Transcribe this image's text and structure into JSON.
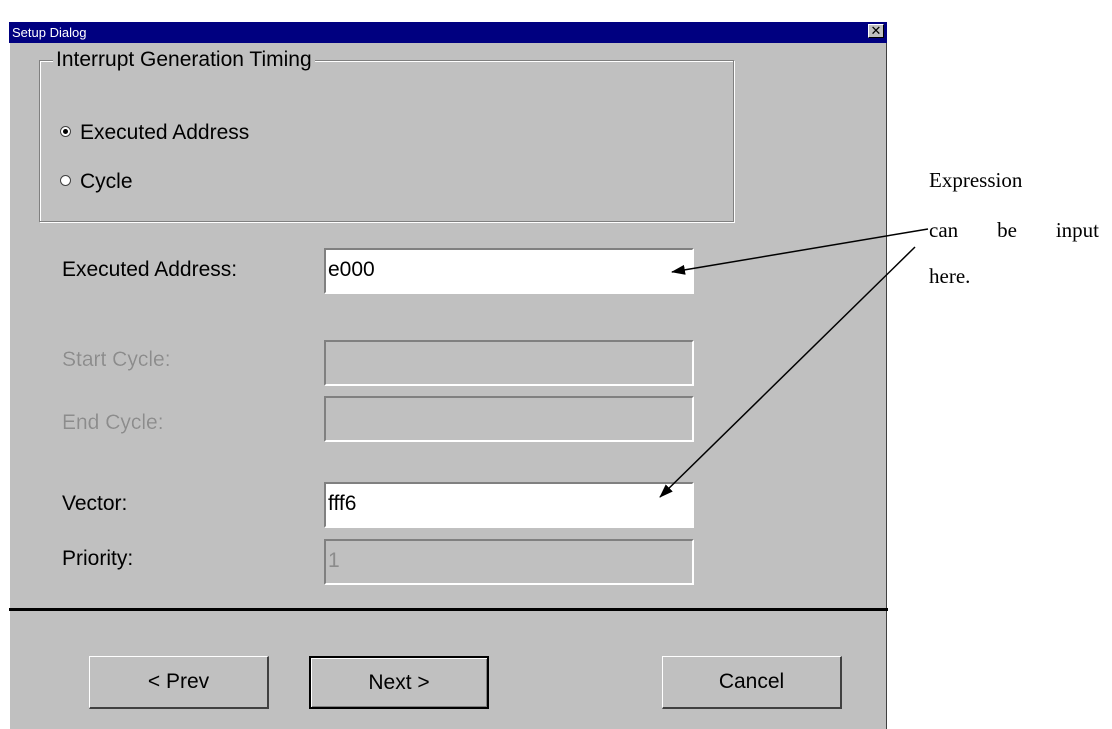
{
  "window": {
    "title": "Setup Dialog",
    "close_glyph": "✕"
  },
  "group": {
    "legend": "Interrupt Generation Timing",
    "options": [
      {
        "label": "Executed Address",
        "checked": true
      },
      {
        "label": "Cycle",
        "checked": false
      }
    ]
  },
  "fields": {
    "executed_address": {
      "label": "Executed Address:",
      "value": "e000",
      "enabled": true
    },
    "start_cycle": {
      "label": "Start Cycle:",
      "value": "",
      "enabled": false
    },
    "end_cycle": {
      "label": "End Cycle:",
      "value": "",
      "enabled": false
    },
    "vector": {
      "label": "Vector:",
      "value": "fff6",
      "enabled": true
    },
    "priority": {
      "label": "Priority:",
      "value": "1",
      "enabled": false
    }
  },
  "buttons": {
    "prev": "< Prev",
    "next": "Next >",
    "cancel": "Cancel"
  },
  "annotation": {
    "line1": "Expression",
    "line2": "can be input",
    "line3": "here."
  }
}
